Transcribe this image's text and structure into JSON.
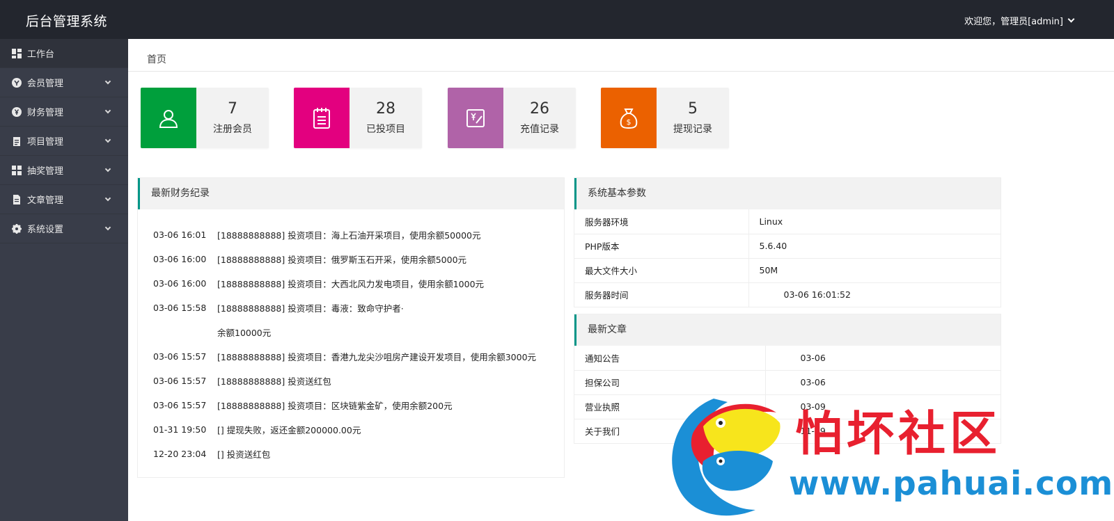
{
  "header": {
    "title": "后台管理系统",
    "user_label": "欢迎您，管理员[admin]"
  },
  "sidebar": {
    "items": [
      {
        "label": "工作台",
        "icon": "dashboard-icon"
      },
      {
        "label": "会员管理",
        "icon": "member-icon"
      },
      {
        "label": "财务管理",
        "icon": "yen-icon"
      },
      {
        "label": "项目管理",
        "icon": "clipboard-icon"
      },
      {
        "label": "抽奖管理",
        "icon": "grid-icon"
      },
      {
        "label": "文章管理",
        "icon": "document-icon"
      },
      {
        "label": "系统设置",
        "icon": "gear-icon"
      }
    ]
  },
  "breadcrumb": {
    "home": "首页"
  },
  "stats": [
    {
      "value": "7",
      "label": "注册会员",
      "color": "#009f3c",
      "icon": "user-icon"
    },
    {
      "value": "28",
      "label": "已投项目",
      "color": "#e3007f",
      "icon": "notepad-icon"
    },
    {
      "value": "26",
      "label": "充值记录",
      "color": "#b063a8",
      "icon": "recharge-icon"
    },
    {
      "value": "5",
      "label": "提现记录",
      "color": "#eb6100",
      "icon": "money-bag-icon"
    }
  ],
  "finance": {
    "title": "最新财务纪录",
    "rows": [
      {
        "time": "03-06 16:01",
        "text": "[18888888888] 投资项目：海上石油开采项目，使用余额50000元"
      },
      {
        "time": "03-06 16:00",
        "text": "[18888888888] 投资项目：俄罗斯玉石开采，使用余额5000元"
      },
      {
        "time": "03-06 16:00",
        "text": "[18888888888] 投资项目：大西北风力发电项目，使用余额1000元"
      },
      {
        "time": "03-06 15:58",
        "text": "[18888888888] 投资项目：毒液：致命守护者·"
      },
      {
        "time": "",
        "text": "余额10000元"
      },
      {
        "time": "03-06 15:57",
        "text": "[18888888888] 投资项目：香港九龙尖沙咀房产建设开发项目，使用余额3000元"
      },
      {
        "time": "03-06 15:57",
        "text": "[18888888888] 投资送红包"
      },
      {
        "time": "03-06 15:57",
        "text": "[18888888888] 投资项目：区块链紫金矿，使用余额200元"
      },
      {
        "time": "01-31 19:50",
        "text": "[] 提现失败，返还金额200000.00元"
      },
      {
        "time": "12-20 23:04",
        "text": "[] 投资送红包"
      }
    ]
  },
  "system": {
    "title": "系统基本参数",
    "rows": [
      {
        "key": "服务器环境",
        "value": "Linux"
      },
      {
        "key": "PHP版本",
        "value": "5.6.40"
      },
      {
        "key": "最大文件大小",
        "value": "50M"
      },
      {
        "key": "服务器时间",
        "value": "03-06 16:01:52"
      }
    ]
  },
  "articles": {
    "title": "最新文章",
    "rows": [
      {
        "key": "通知公告",
        "value": "03-06"
      },
      {
        "key": "担保公司",
        "value": "03-06"
      },
      {
        "key": "营业执照",
        "value": "03-09"
      },
      {
        "key": "关于我们",
        "value": "11-19"
      }
    ]
  },
  "watermark": {
    "text": "怕坏社区",
    "url": "www.pahuai.com"
  }
}
